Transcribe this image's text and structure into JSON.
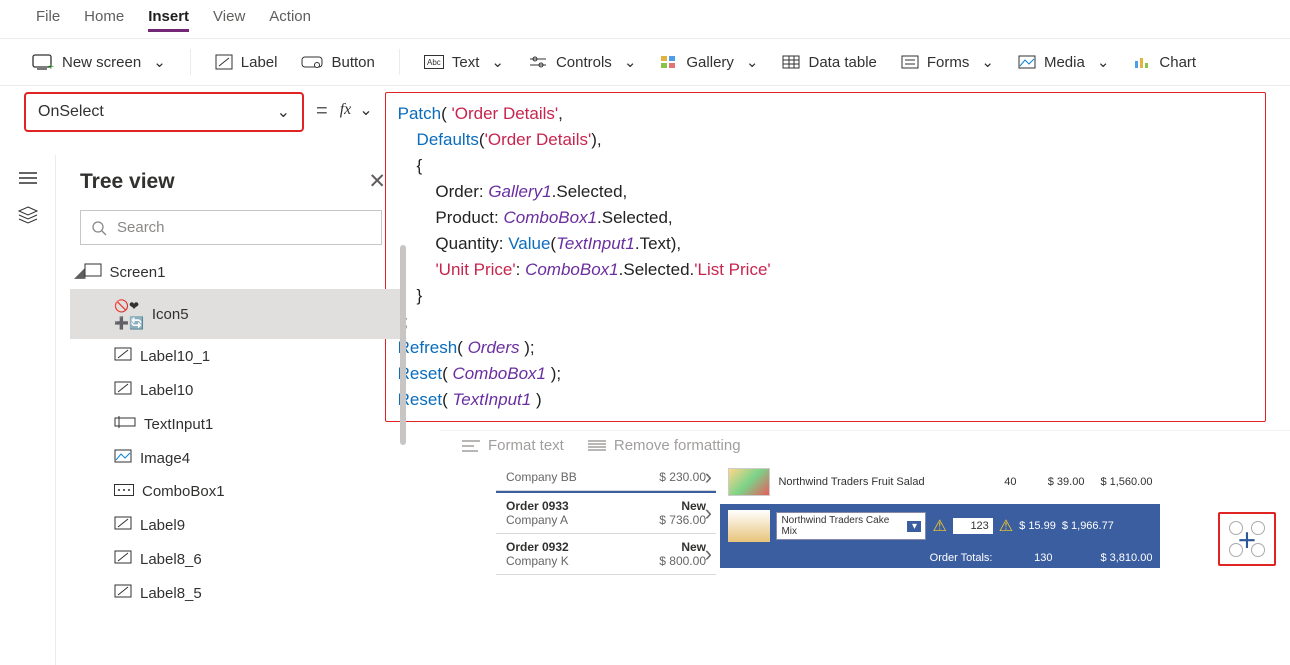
{
  "menu": {
    "items": [
      "File",
      "Home",
      "Insert",
      "View",
      "Action"
    ],
    "active": "Insert"
  },
  "ribbon": {
    "new_screen": "New screen",
    "label": "Label",
    "button": "Button",
    "text": "Text",
    "controls": "Controls",
    "gallery": "Gallery",
    "data_table": "Data table",
    "forms": "Forms",
    "media": "Media",
    "chart": "Chart"
  },
  "property_dropdown": {
    "value": "OnSelect"
  },
  "formula_tokens": [
    {
      "t": "fn",
      "v": "Patch"
    },
    {
      "t": "txt",
      "v": "( "
    },
    {
      "t": "str",
      "v": "'Order Details'"
    },
    {
      "t": "txt",
      "v": ",\n    "
    },
    {
      "t": "fn",
      "v": "Defaults"
    },
    {
      "t": "txt",
      "v": "("
    },
    {
      "t": "str",
      "v": "'Order Details'"
    },
    {
      "t": "txt",
      "v": "),\n    {\n        Order: "
    },
    {
      "t": "id",
      "v": "Gallery1"
    },
    {
      "t": "txt",
      "v": ".Selected,\n        Product: "
    },
    {
      "t": "id",
      "v": "ComboBox1"
    },
    {
      "t": "txt",
      "v": ".Selected,\n        Quantity: "
    },
    {
      "t": "fn",
      "v": "Value"
    },
    {
      "t": "txt",
      "v": "("
    },
    {
      "t": "id",
      "v": "TextInput1"
    },
    {
      "t": "txt",
      "v": ".Text),\n        "
    },
    {
      "t": "str",
      "v": "'Unit Price'"
    },
    {
      "t": "txt",
      "v": ": "
    },
    {
      "t": "id",
      "v": "ComboBox1"
    },
    {
      "t": "txt",
      "v": ".Selected."
    },
    {
      "t": "str",
      "v": "'List Price'"
    },
    {
      "t": "txt",
      "v": "\n    }\n);\n"
    },
    {
      "t": "fn",
      "v": "Refresh"
    },
    {
      "t": "txt",
      "v": "( "
    },
    {
      "t": "id",
      "v": "Orders"
    },
    {
      "t": "txt",
      "v": " );\n"
    },
    {
      "t": "fn",
      "v": "Reset"
    },
    {
      "t": "txt",
      "v": "( "
    },
    {
      "t": "id",
      "v": "ComboBox1"
    },
    {
      "t": "txt",
      "v": " );\n"
    },
    {
      "t": "fn",
      "v": "Reset"
    },
    {
      "t": "txt",
      "v": "( "
    },
    {
      "t": "id",
      "v": "TextInput1"
    },
    {
      "t": "txt",
      "v": " )"
    }
  ],
  "tree": {
    "title": "Tree view",
    "search_placeholder": "Search",
    "nodes": [
      {
        "label": "Screen1",
        "icon": "screen",
        "root": true
      },
      {
        "label": "Icon5",
        "icon": "icon5",
        "selected": true
      },
      {
        "label": "Label10_1",
        "icon": "label"
      },
      {
        "label": "Label10",
        "icon": "label"
      },
      {
        "label": "TextInput1",
        "icon": "textinput"
      },
      {
        "label": "Image4",
        "icon": "image"
      },
      {
        "label": "ComboBox1",
        "icon": "combo"
      },
      {
        "label": "Label9",
        "icon": "label"
      },
      {
        "label": "Label8_6",
        "icon": "label"
      },
      {
        "label": "Label8_5",
        "icon": "label"
      }
    ]
  },
  "format_bar": {
    "format": "Format text",
    "remove": "Remove formatting"
  },
  "preview": {
    "orders": [
      {
        "company": "Company BB",
        "amount": "$ 230.00",
        "title": "",
        "status": ""
      },
      {
        "title": "Order 0933",
        "status": "New",
        "company": "Company A",
        "amount": "$ 736.00"
      },
      {
        "title": "Order 0932",
        "status": "New",
        "company": "Company K",
        "amount": "$ 800.00"
      }
    ],
    "line1": {
      "name": "Northwind Traders Fruit Salad",
      "qty": "40",
      "price": "$ 39.00",
      "total": "$ 1,560.00"
    },
    "selected": {
      "combo": "Northwind Traders Cake Mix",
      "qty": "123",
      "price": "$ 15.99",
      "total": "$ 1,966.77"
    },
    "totals": {
      "label": "Order Totals:",
      "qty": "130",
      "grand": "$ 3,810.00"
    }
  }
}
